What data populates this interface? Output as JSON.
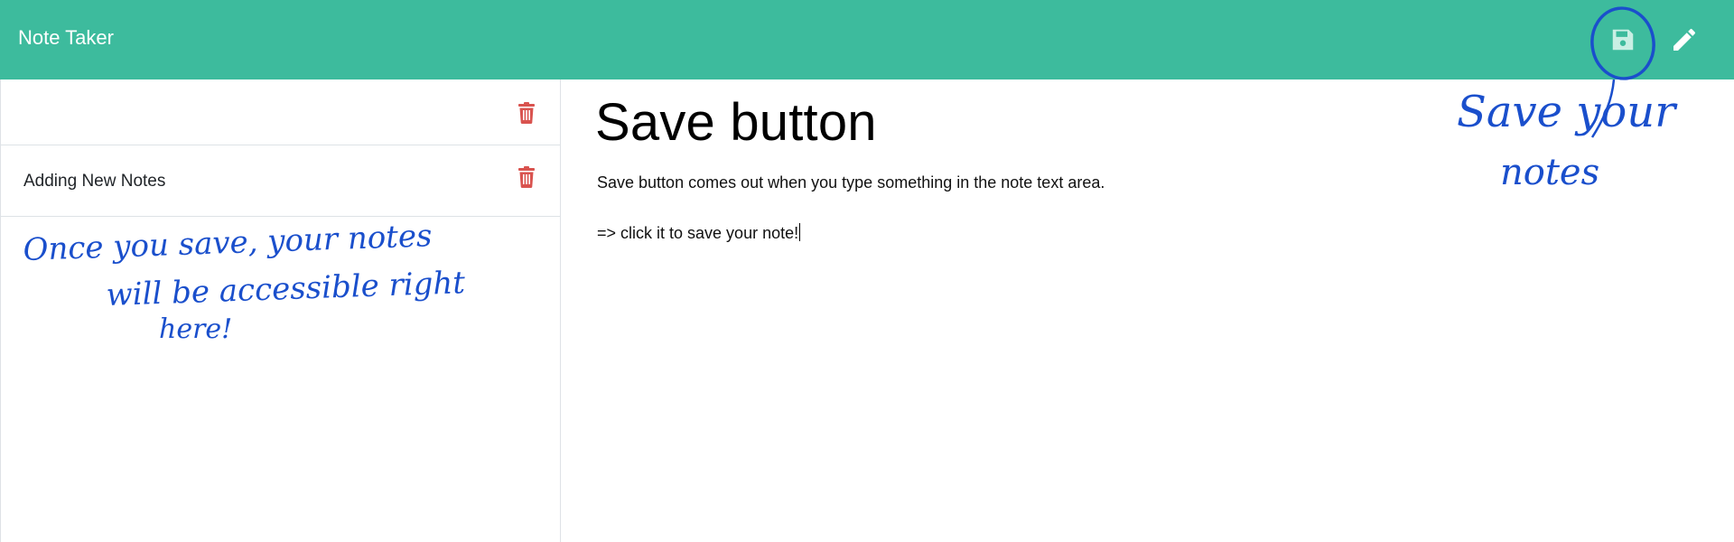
{
  "app": {
    "title": "Note Taker"
  },
  "toolbar": {
    "save_icon": "save-icon",
    "edit_icon": "pencil-icon"
  },
  "sidebar": {
    "items": [
      {
        "label": "",
        "delete_icon": "trash-icon"
      },
      {
        "label": "Adding New Notes",
        "delete_icon": "trash-icon"
      }
    ]
  },
  "editor": {
    "title": "Save button",
    "lines": [
      "Save button comes out when you type something in the note text area.",
      "=> click it to save your note!"
    ]
  },
  "annotations": {
    "sidebar_note": [
      "Once you save, your notes",
      "will be accessible right",
      "here!"
    ],
    "save_note": [
      "Save your",
      "notes"
    ]
  },
  "colors": {
    "header": "#3dbb9d",
    "trash": "#d9534f",
    "annotation_ink": "#1a4fcc"
  }
}
